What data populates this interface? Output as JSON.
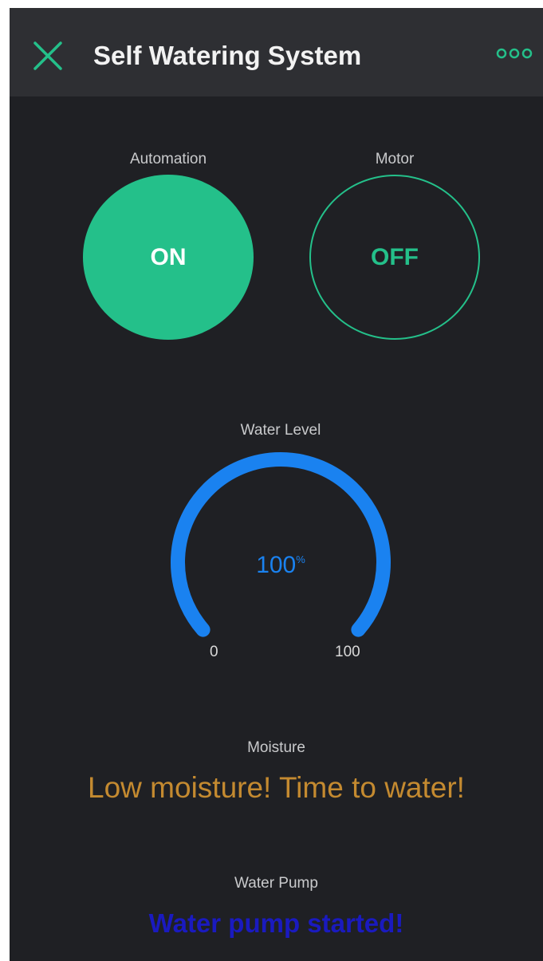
{
  "header": {
    "title": "Self Watering System",
    "close_icon": "close-icon",
    "more_icon": "more-dots-icon"
  },
  "automation": {
    "label": "Automation",
    "state": "ON"
  },
  "motor": {
    "label": "Motor",
    "state": "OFF"
  },
  "water_level": {
    "label": "Water Level",
    "value": 100,
    "display": "100",
    "unit": "%",
    "min": "0",
    "max": "100"
  },
  "moisture": {
    "label": "Moisture",
    "message": "Low moisture! Time to water!"
  },
  "water_pump": {
    "label": "Water Pump",
    "message": "Water pump started!"
  },
  "colors": {
    "accent_green": "#24c08a",
    "gauge_blue": "#1a82f0",
    "warning_orange": "#c48a30",
    "pump_blue": "#1a1abf",
    "background": "#1f2024",
    "header_bg": "#2e2f33"
  }
}
